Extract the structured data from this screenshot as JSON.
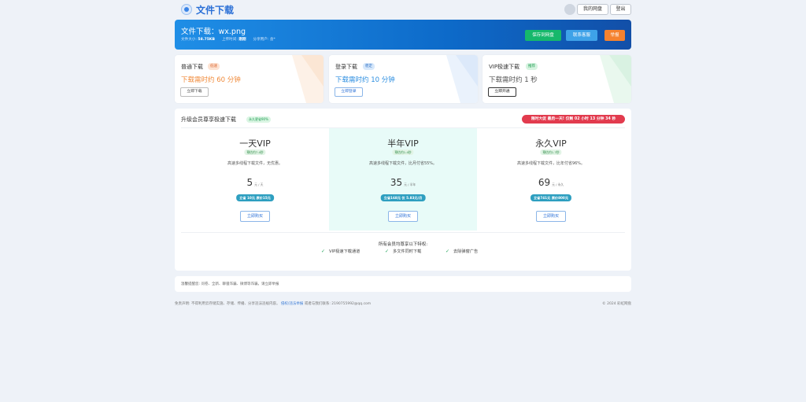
{
  "header": {
    "site_title": "文件下载",
    "my_disk": "我的网盘",
    "logout": "登出"
  },
  "file": {
    "title": "文件下载：wx.png",
    "size_label": "文件大小:",
    "size_value": "58.75KB",
    "upload_label": "上传时间:",
    "upload_value": "刚刚",
    "share_label": "分享用户:",
    "share_value": "含*",
    "save_btn": "保存到网盘",
    "contact_btn": "联系客服",
    "report_btn": "举报"
  },
  "download_options": [
    {
      "name": "普通下载",
      "badge": "低速",
      "time": "下载需时约 60 分钟",
      "button": "立即下载"
    },
    {
      "name": "登录下载",
      "badge": "稳定",
      "time": "下载需时约 10 分钟",
      "button": "立即登录"
    },
    {
      "name": "VIP极速下载",
      "badge": "推荐",
      "time": "下载需时约 1 秒",
      "button": "立即开通"
    }
  ],
  "vip": {
    "title": "升级会员尊享极速下载",
    "title_badge": "永久更省90%",
    "promo": "限时大促 最后一天! 仅剩 02 小时 13 分钟 34 秒",
    "plans": [
      {
        "name": "一天VIP",
        "tag": "预估约7.4秒",
        "desc": "高速多线程下载文件，无优惠。",
        "price": "5",
        "unit": "元 / 天",
        "note": "立省 10元 原价15元",
        "button": "立即购买"
      },
      {
        "name": "半年VIP",
        "tag": "预估约1.4秒",
        "desc": "高速多线程下载文件，比月付省55%。",
        "price": "35",
        "unit": "元 / 半年",
        "note": "立省168元 仅 5.83元/月",
        "button": "立即购买"
      },
      {
        "name": "永久VIP",
        "tag": "预估约1.7秒",
        "desc": "高速多线程下载文件，比年付省96%。",
        "price": "69",
        "unit": "元 / 永久",
        "note": "立省741元 原价800元",
        "button": "立即购买"
      }
    ],
    "benefits_title": "所有会员均尊享以下特权:",
    "benefits": [
      "VIP极速下载通道",
      "多文件同时下载",
      "去除弹窗广告"
    ]
  },
  "notice": {
    "text": "温馨提醒您: 问卷、全新、聊骚诈骗、微博等诈骗，请立即举报"
  },
  "footer": {
    "disclaimer": "免责声明: 不得利用云存储实施、存储、传播、分享违法违规内容。",
    "link": "侵权/违法举报",
    "email_label": "或者与我们联系: 2190755992@qq.com",
    "copyright": "© 2024 彩虹网盘"
  },
  "colors": {
    "accent": "#2a6fd6",
    "banner_start": "#1f8ee6",
    "banner_end": "#124fa8",
    "save_green": "#16b86b",
    "contact_blue": "#3ea2e8",
    "report_orange": "#f5822f",
    "promo_red": "#e23b4e",
    "slow_orange": "#f08a3a",
    "fast_blue": "#2c8ee0"
  }
}
